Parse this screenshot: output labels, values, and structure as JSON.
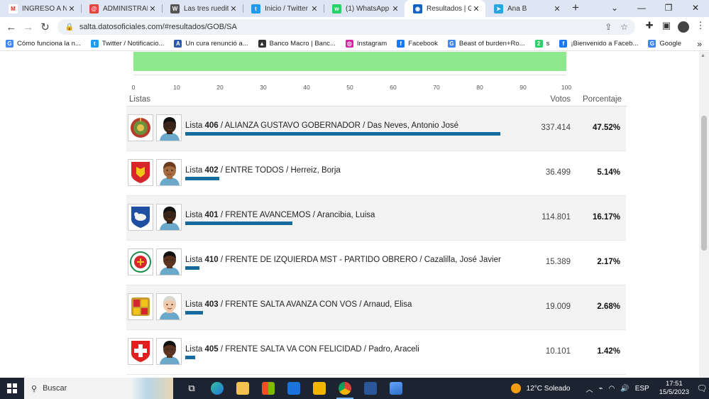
{
  "browser": {
    "tabs": [
      {
        "title": "INGRESO A NDR",
        "favicon_color": "#ffffff",
        "favicon_glyph": "M",
        "active": false
      },
      {
        "title": "ADMINISTRADOR",
        "favicon_color": "#e0473a",
        "favicon_glyph": "@",
        "active": false
      },
      {
        "title": "Las tres rueditas",
        "favicon_color": "#555555",
        "favicon_glyph": "W",
        "active": false
      },
      {
        "title": "Inicio / Twitter",
        "favicon_color": "#1d9bf0",
        "favicon_glyph": "t",
        "active": false
      },
      {
        "title": "(1) WhatsApp",
        "favicon_color": "#25d366",
        "favicon_glyph": "w",
        "active": false
      },
      {
        "title": "Resultados | Gob",
        "favicon_color": "#1565c0",
        "favicon_glyph": "◉",
        "active": true
      },
      {
        "title": "Ana B",
        "favicon_color": "#2aa3df",
        "favicon_glyph": "➤",
        "active": false
      }
    ],
    "new_tab_glyph": "+",
    "url": "salta.datosoficiales.com/#resultados/GOB/SA",
    "bookmarks": [
      {
        "label": "Cómo funciona la n...",
        "color": "#4285f4",
        "glyph": "G"
      },
      {
        "label": "Twitter / Notificacio...",
        "color": "#1d9bf0",
        "glyph": "t"
      },
      {
        "label": "Un cura renunció a...",
        "color": "#2b5aa8",
        "glyph": "A"
      },
      {
        "label": "Banco Macro | Banc...",
        "color": "#333333",
        "glyph": "▲"
      },
      {
        "label": "Instagram",
        "color": "#d6249f",
        "glyph": "◎"
      },
      {
        "label": "Facebook",
        "color": "#1877f2",
        "glyph": "f"
      },
      {
        "label": "Beast of burden+Ro...",
        "color": "#4285f4",
        "glyph": "G"
      },
      {
        "label": "s",
        "color": "#25d366",
        "glyph": "2"
      },
      {
        "label": "¡Bienvenido a Faceb...",
        "color": "#1877f2",
        "glyph": "f"
      },
      {
        "label": "Google",
        "color": "#4285f4",
        "glyph": "G"
      }
    ],
    "bookmarks_more": "»"
  },
  "results": {
    "chart_data": {
      "type": "bar",
      "values": [
        100
      ],
      "xlim": [
        0,
        100
      ],
      "ticks": [
        "0",
        "10",
        "20",
        "30",
        "40",
        "50",
        "60",
        "70",
        "80",
        "90",
        "100"
      ],
      "bar_color": "#8ee88e"
    },
    "headers": {
      "lists": "Listas",
      "votes": "Votos",
      "percent": "Porcentaje"
    },
    "list_prefix": "Lista",
    "rows": [
      {
        "number": "406",
        "rest": " / ALIANZA GUSTAVO GOBERNADOR / Das Neves, Antonio José",
        "votes": "337.414",
        "percent": "47.52%",
        "share": 47.52,
        "badge": "emblem-green",
        "skin": "#3b2418",
        "hair": "#111111"
      },
      {
        "number": "402",
        "rest": " / ENTRE TODOS / Herreiz, Borja",
        "votes": "36.499",
        "percent": "5.14%",
        "share": 5.14,
        "badge": "red-lion",
        "skin": "#a56a3e",
        "hair": "#6b3b1c"
      },
      {
        "number": "401",
        "rest": " / FRENTE AVANCEMOS / Arancibia, Luisa",
        "votes": "114.801",
        "percent": "16.17%",
        "share": 16.17,
        "badge": "blue-ram",
        "skin": "#3b2418",
        "hair": "#111111"
      },
      {
        "number": "410",
        "rest": " / FRENTE DE IZQUIERDA MST - PARTIDO OBRERO / Cazalilla, José Javier",
        "votes": "15.389",
        "percent": "2.17%",
        "share": 2.17,
        "badge": "red-circle",
        "skin": "#5a3220",
        "hair": "#111111"
      },
      {
        "number": "403",
        "rest": " / FRENTE SALTA AVANZA CON VOS / Arnaud, Elisa",
        "votes": "19.009",
        "percent": "2.68%",
        "share": 2.68,
        "badge": "andorra",
        "skin": "#f0c9a8",
        "hair": "#d8d8d0"
      },
      {
        "number": "405",
        "rest": " / FRENTE SALTA VA CON FELICIDAD / Padro, Araceli",
        "votes": "10.101",
        "percent": "1.42%",
        "share": 1.42,
        "badge": "swiss-cross",
        "skin": "#5a3220",
        "hair": "#111111"
      }
    ]
  },
  "taskbar": {
    "search_placeholder": "Buscar",
    "weather": "12°C  Soleado",
    "lang": "ESP",
    "time": "17:51",
    "date": "15/5/2023"
  }
}
